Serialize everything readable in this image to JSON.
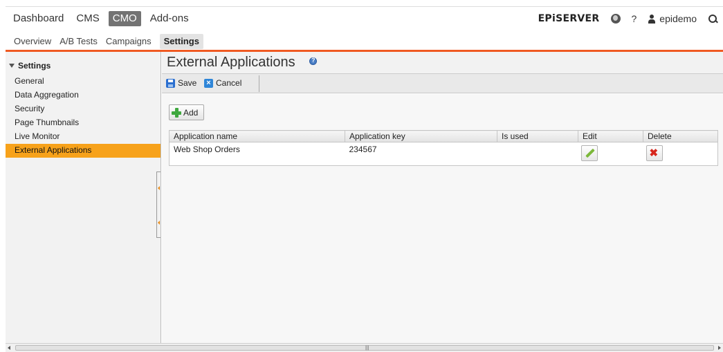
{
  "nav": {
    "main": [
      "Dashboard",
      "CMS",
      "CMO",
      "Add-ons"
    ],
    "active_main": "CMO",
    "sub": [
      "Overview",
      "A/B Tests",
      "Campaigns",
      "Settings"
    ],
    "active_sub": "Settings",
    "brand": "EPiSERVER",
    "help": "?",
    "username": "epidemo"
  },
  "sidebar": {
    "heading": "Settings",
    "items": [
      {
        "label": "General"
      },
      {
        "label": "Data Aggregation"
      },
      {
        "label": "Security"
      },
      {
        "label": "Page Thumbnails"
      },
      {
        "label": "Live Monitor"
      },
      {
        "label": "External Applications",
        "active": true
      }
    ]
  },
  "page": {
    "title": "External Applications",
    "toolbar": {
      "save": "Save",
      "cancel": "Cancel"
    },
    "add_label": "Add"
  },
  "table": {
    "columns": [
      "Application name",
      "Application key",
      "Is used",
      "Edit",
      "Delete"
    ],
    "rows": [
      {
        "name": "Web Shop Orders",
        "key": "234567",
        "is_used": ""
      }
    ]
  },
  "colors": {
    "accent": "#f05a22",
    "selected": "#f7a21b",
    "active_menu": "#737373"
  },
  "icons": [
    "globe-icon",
    "user-icon",
    "search-icon",
    "help-icon",
    "save-icon",
    "cancel-icon",
    "add-icon",
    "edit-icon",
    "delete-icon"
  ]
}
